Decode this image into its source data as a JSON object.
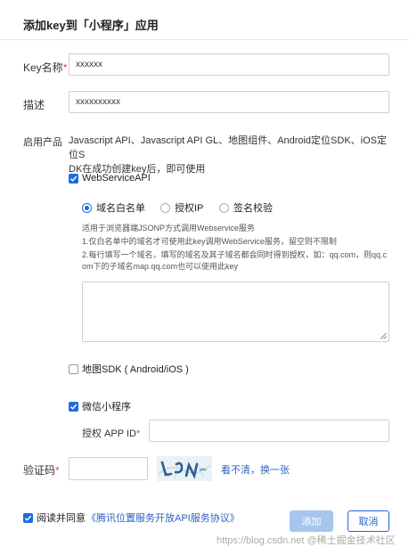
{
  "dialog": {
    "title": "添加key到「小程序」应用"
  },
  "form": {
    "key_name": {
      "label": "Key名称",
      "required_mark": "*",
      "value": "xxxxxx"
    },
    "description": {
      "label": "描述",
      "value": "xxxxxxxxxx"
    },
    "products": {
      "label": "启用产品",
      "desc_line1": "Javascript API、Javascript API GL、地图组件、Android定位SDK、iOS定位S",
      "desc_line2": "DK在成功创建key后，即可使用"
    },
    "webservice": {
      "label": "WebServiceAPI",
      "checked": true,
      "options": [
        {
          "label": "域名白名单",
          "selected": true
        },
        {
          "label": "授权IP",
          "selected": false
        },
        {
          "label": "签名校验",
          "selected": false
        }
      ],
      "hint_lines": [
        "适用于浏览器端JSONP方式调用Webservice服务",
        "1.仅白名单中的域名才可使用此key调用WebService服务，留空则不限制",
        "2.每行填写一个域名，填写的域名及其子域名都会同时得到授权，如：qq.com，则qq.c",
        "om下的子域名map.qq.com也可以使用此key"
      ],
      "whitelist_value": ""
    },
    "map_sdk": {
      "label": "地图SDK ( Android/iOS )",
      "checked": false
    },
    "mini_program": {
      "label": "微信小程序",
      "checked": true,
      "appid_label": "授权 APP ID",
      "appid_required_mark": "*",
      "appid_value": ""
    },
    "captcha": {
      "label": "验证码",
      "required_mark": "*",
      "value": "",
      "refresh_link": "看不清，换一张"
    }
  },
  "footer": {
    "agree_checked": true,
    "agree_prefix": "阅读并同意",
    "agreement_link": "《腾讯位置服务开放API服务协议》",
    "add_button": "添加",
    "cancel_button": "取消",
    "watermark": "https://blog.csdn.net @稀土掘金技术社区"
  },
  "colors": {
    "accent": "#1e6ae0",
    "required": "#e5443c",
    "primary_disabled": "#a6c6ef",
    "link": "#2a64c2"
  }
}
